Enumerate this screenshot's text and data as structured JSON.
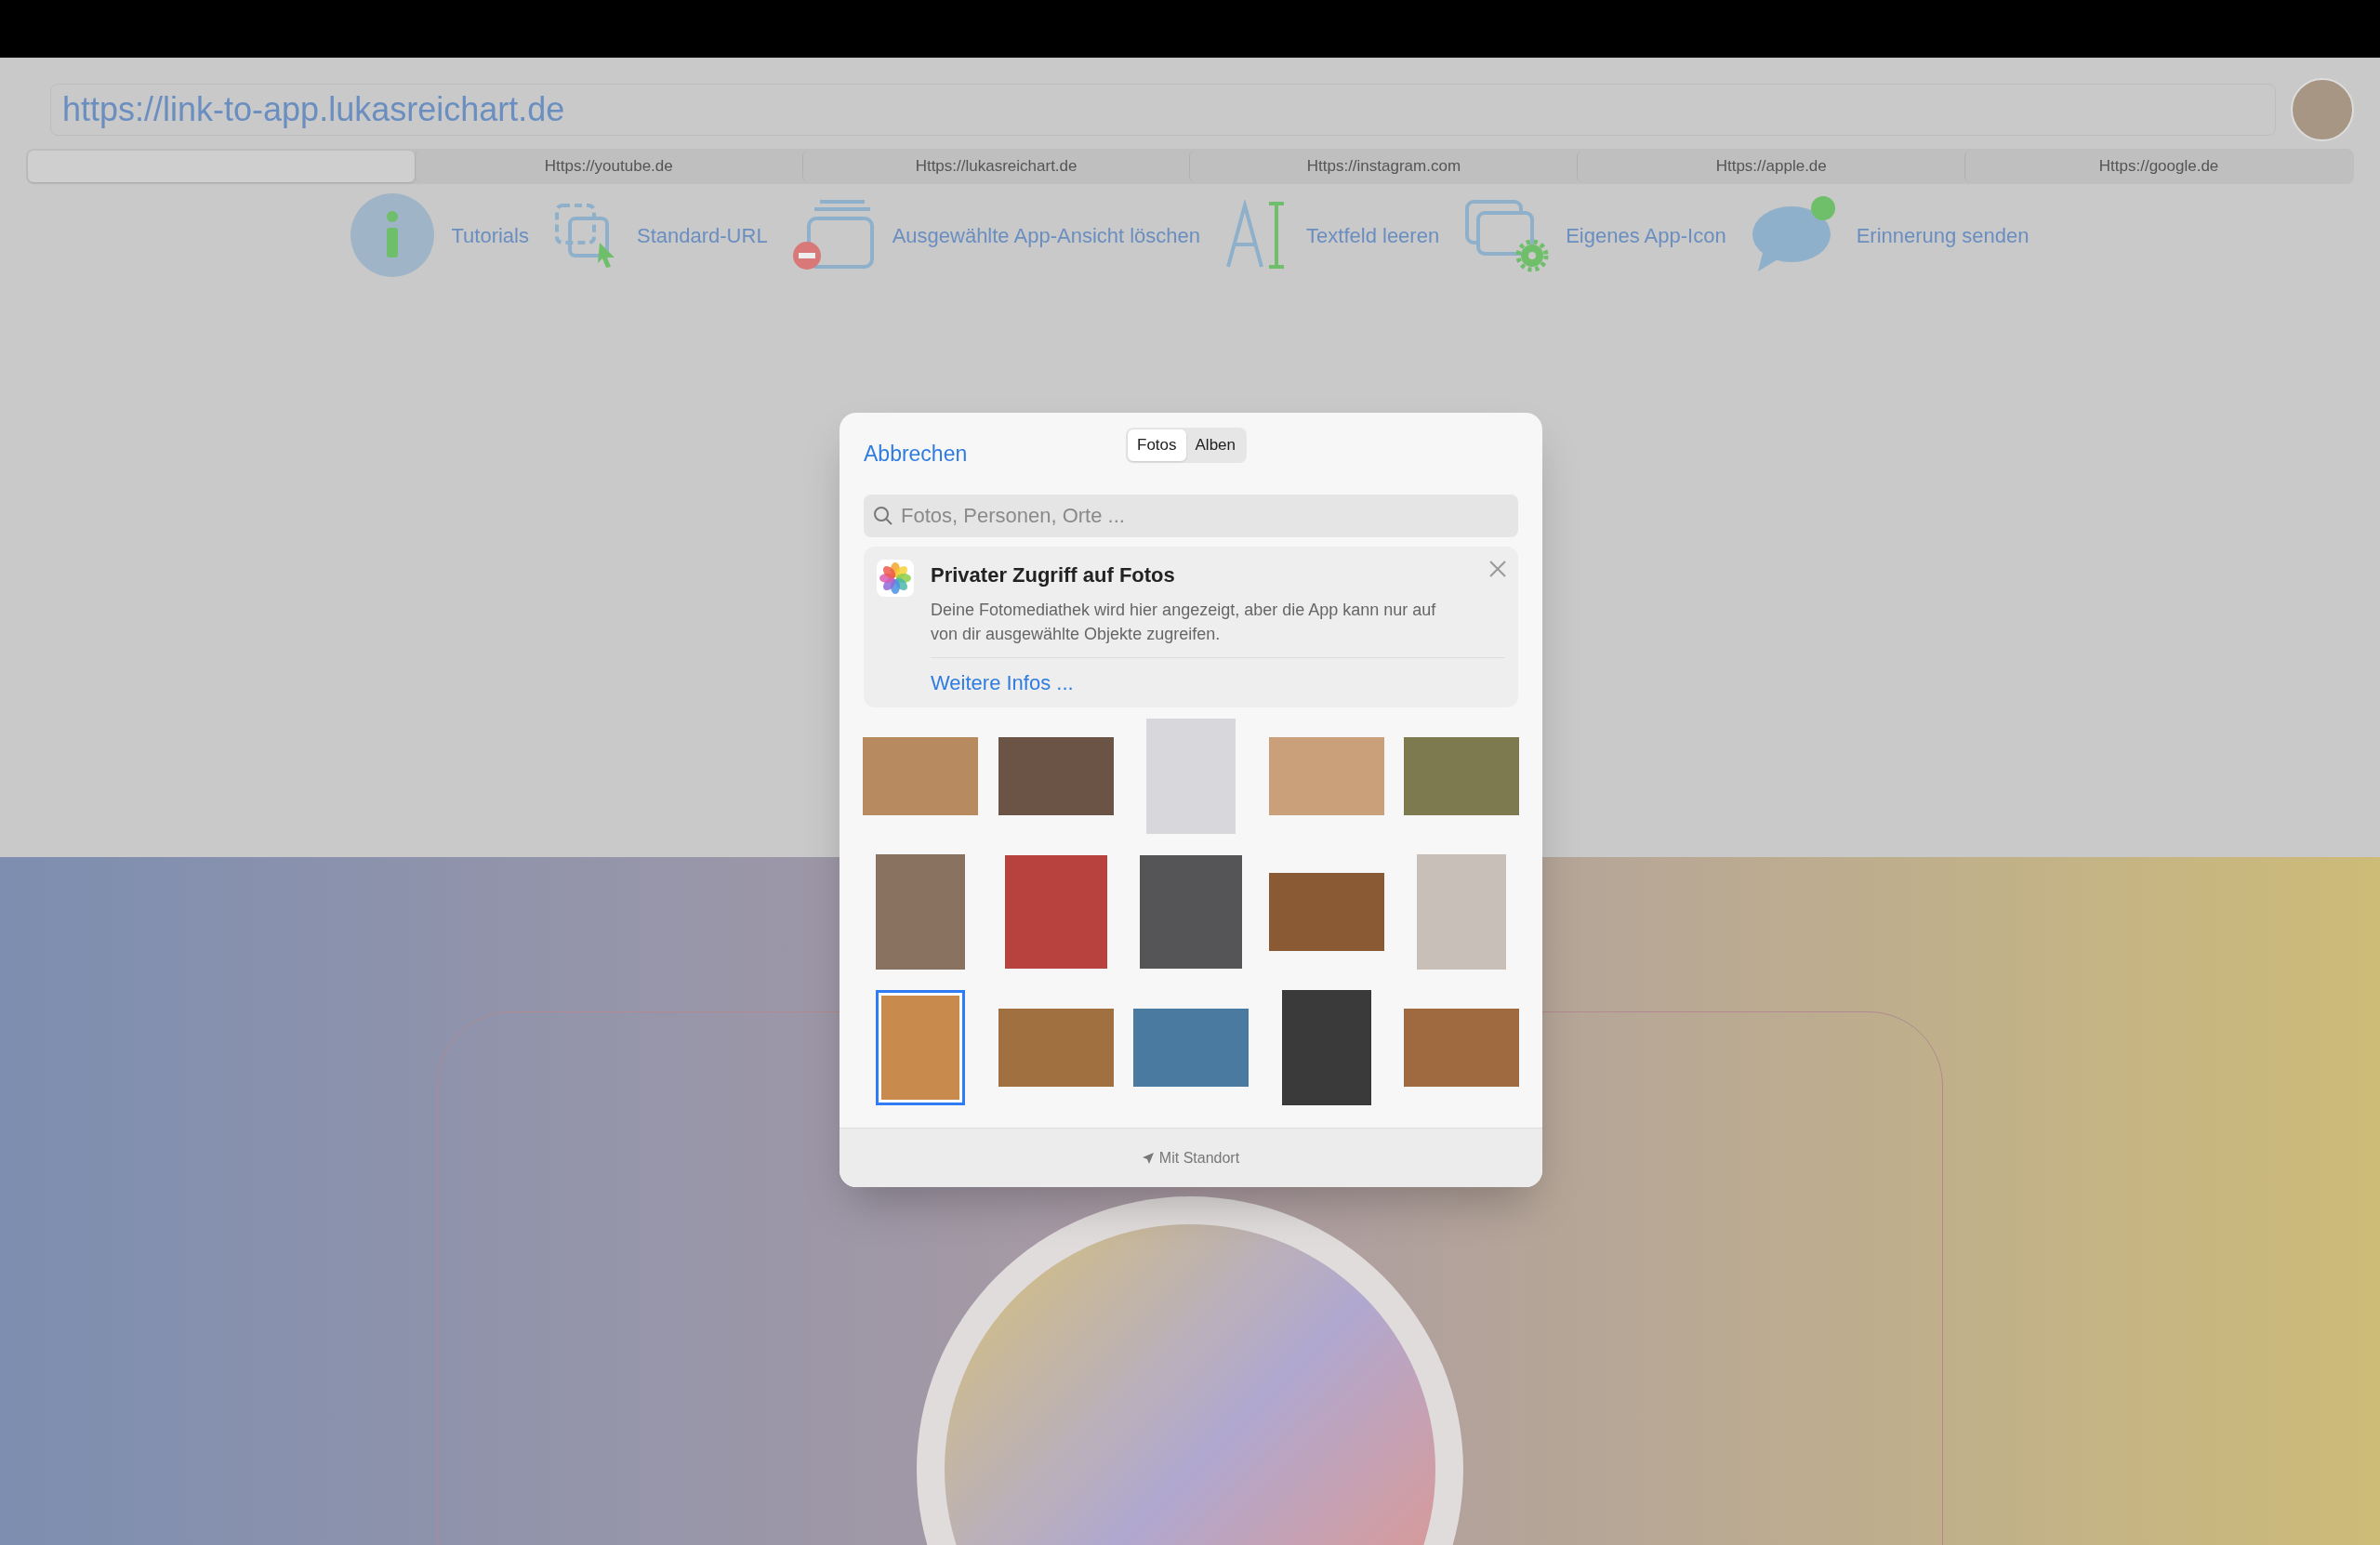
{
  "address_bar": {
    "url": "https://link-to-app.lukasreichart.de"
  },
  "tabs": [
    {
      "selected": true
    },
    {
      "label": "Https://youtube.de",
      "selected": false
    },
    {
      "label": "Https://lukasreichart.de",
      "selected": false
    },
    {
      "label": "Https://instagram.com",
      "selected": false
    },
    {
      "label": "Https://apple.de",
      "selected": false
    },
    {
      "label": "Https://google.de",
      "selected": false
    }
  ],
  "toolbar": [
    "Tutorials",
    "Standard-URL",
    "Ausgewählte App-Ansicht löschen",
    "Textfeld leeren",
    "Eigenes App-Icon",
    "Erinnerung senden"
  ],
  "photo_picker": {
    "cancel": "Abbrechen",
    "segments": [
      {
        "label": "Fotos",
        "selected": true
      },
      {
        "label": "Alben",
        "selected": false
      }
    ],
    "search": {
      "placeholder": "Fotos, Personen, Orte ..."
    },
    "notice": {
      "title": "Privater Zugriff auf Fotos",
      "body": "Deine Fotomediathek wird hier angezeigt, aber die App kann nur auf von dir ausgewählte Objekte zugreifen.",
      "link": "Weitere Infos ..."
    },
    "photos": [
      {
        "kind": "landscape",
        "selected": false
      },
      {
        "kind": "landscape",
        "selected": false
      },
      {
        "kind": "portrait",
        "selected": false
      },
      {
        "kind": "landscape",
        "selected": false
      },
      {
        "kind": "landscape",
        "selected": false
      },
      {
        "kind": "portrait",
        "selected": false
      },
      {
        "kind": "square",
        "selected": false
      },
      {
        "kind": "square",
        "selected": false
      },
      {
        "kind": "landscape",
        "selected": false
      },
      {
        "kind": "portrait",
        "selected": false
      },
      {
        "kind": "portrait",
        "selected": true
      },
      {
        "kind": "landscape",
        "selected": false
      },
      {
        "kind": "landscape",
        "selected": false
      },
      {
        "kind": "portrait",
        "selected": false
      },
      {
        "kind": "landscape",
        "selected": false
      }
    ],
    "footer": "Mit Standort"
  }
}
